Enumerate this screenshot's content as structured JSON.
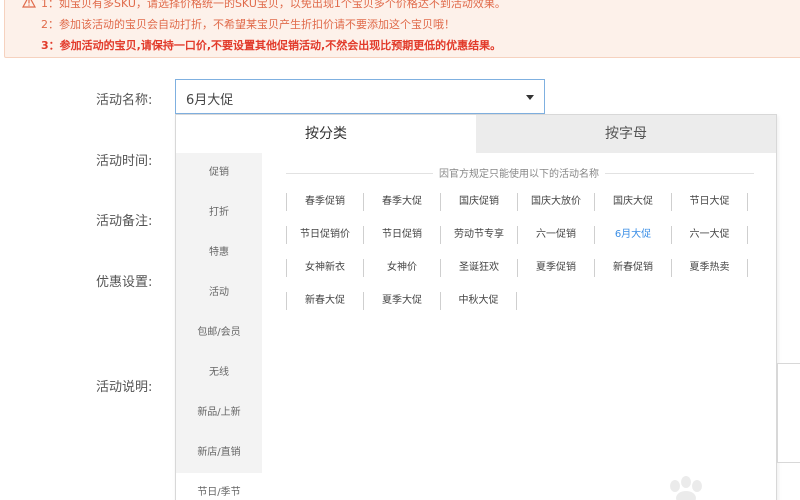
{
  "notice": {
    "lines": [
      "1：如宝贝有多SKU，请选择价格统一的SKU宝贝，以免出现1个宝贝多个价格达不到活动效果。",
      "2：参加该活动的宝贝会自动打折，不希望某宝贝产生折扣价请不要添加这个宝贝哦！",
      "3：参加活动的宝贝,请保持一口价,不要设置其他促销活动,不然会出现比预期更低的优惠结果。"
    ]
  },
  "form": {
    "activity_name_label": "活动名称:",
    "activity_time_label": "活动时间:",
    "activity_note_label": "活动备注:",
    "discount_setting_label": "优惠设置:",
    "activity_desc_label": "活动说明:"
  },
  "select": {
    "value": "6月大促"
  },
  "dropdown": {
    "tabs": [
      "按分类",
      "按字母"
    ],
    "categories": [
      "促销",
      "打折",
      "特惠",
      "活动",
      "包邮/会员",
      "无线",
      "新品/上新",
      "新店/直销",
      "节日/季节"
    ],
    "hint": "因官方规定只能使用以下的活动名称",
    "names": [
      [
        "春季促销",
        "春季大促",
        "国庆促销",
        "国庆大放价",
        "国庆大促",
        "节日大促"
      ],
      [
        "节日促销价",
        "节日促销",
        "劳动节专享",
        "六一促销",
        "6月大促",
        "六一大促"
      ],
      [
        "女神新衣",
        "女神价",
        "圣诞狂欢",
        "夏季促销",
        "新春促销",
        "夏季热卖"
      ],
      [
        "新春大促",
        "夏季大促",
        "中秋大促"
      ]
    ],
    "selected": "6月大促"
  },
  "colors": {
    "notice_bg": "#fdf1ea",
    "notice_text": "#e06a4a",
    "notice_emphasis": "#e23a2a",
    "selected_accent": "#3a8ee6",
    "select_border": "#7fb0e0"
  },
  "icons": {
    "notice": "warning-icon",
    "select": "caret-down-icon"
  }
}
